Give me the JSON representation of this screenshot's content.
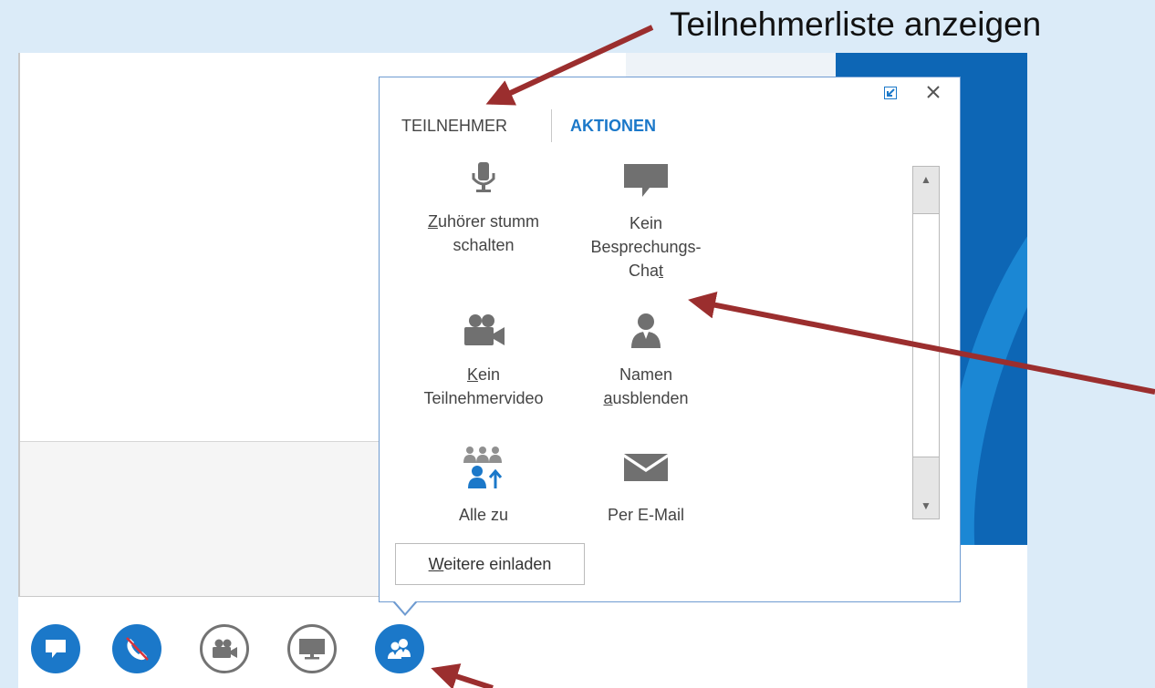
{
  "annotation": {
    "title": "Teilnehmerliste anzeigen"
  },
  "popup": {
    "tabs": {
      "participants": "TEILNEHMER",
      "actions": "AKTIONEN"
    },
    "actions": [
      {
        "line1_accel": "Z",
        "line1": "uhörer stumm",
        "line2": "schalten",
        "line3": "",
        "icon": "microphone-icon"
      },
      {
        "line1": "Kein",
        "line2": "Besprechungs-",
        "line3_pre": "Cha",
        "line3_accel": "t",
        "icon": "chat-bubble-icon"
      },
      {
        "line1_accel": "K",
        "line1": "ein",
        "line2": "Teilnehmervideo",
        "icon": "video-camera-icon"
      },
      {
        "line1": "Namen",
        "line2_accel": "a",
        "line2": "usblenden",
        "icon": "person-icon"
      },
      {
        "line1": "Alle zu",
        "icon": "group-promote-icon"
      },
      {
        "line1": "Per E-Mail",
        "icon": "envelope-icon"
      }
    ],
    "invite_button": {
      "accel": "W",
      "rest": "eitere einladen"
    }
  },
  "colors": {
    "accent": "#1b78c9",
    "annotation_arrow": "#9b2e2e",
    "popup_border": "#6e9bd1"
  }
}
